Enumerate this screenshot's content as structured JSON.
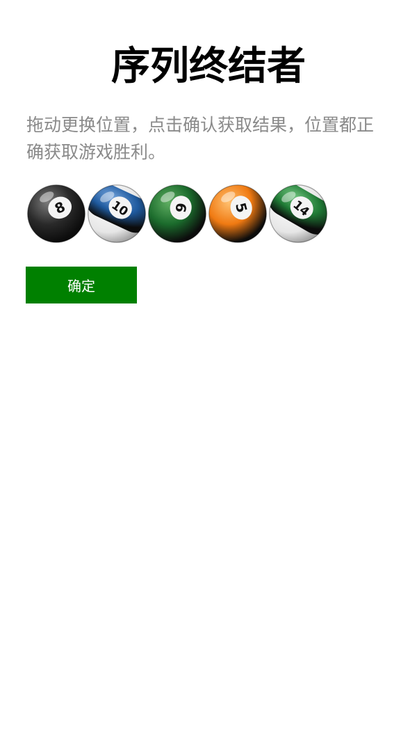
{
  "title": "序列终结者",
  "instructions": "拖动更换位置，点击确认获取结果，位置都正确获取游戏胜利。",
  "balls": [
    {
      "number": "8",
      "style": "solid",
      "color": "#2a2a2a",
      "highlight": "#7a7a7a",
      "rotation": -25
    },
    {
      "number": "10",
      "style": "stripe",
      "color": "#1f5a9e",
      "highlight": "#6f9fd8",
      "rotation": 35
    },
    {
      "number": "6",
      "style": "solid",
      "color": "#1b6b2c",
      "highlight": "#5fae62",
      "rotation": 100
    },
    {
      "number": "5",
      "style": "solid",
      "color": "#f07a12",
      "highlight": "#ffc070",
      "rotation": 75
    },
    {
      "number": "14",
      "style": "stripe",
      "color": "#1f7a35",
      "highlight": "#6cc07a",
      "rotation": 40
    }
  ],
  "confirm_label": "确定",
  "colors": {
    "button_bg": "#008000",
    "button_text": "#ffffff",
    "instructions_text": "#8a8a8a"
  }
}
